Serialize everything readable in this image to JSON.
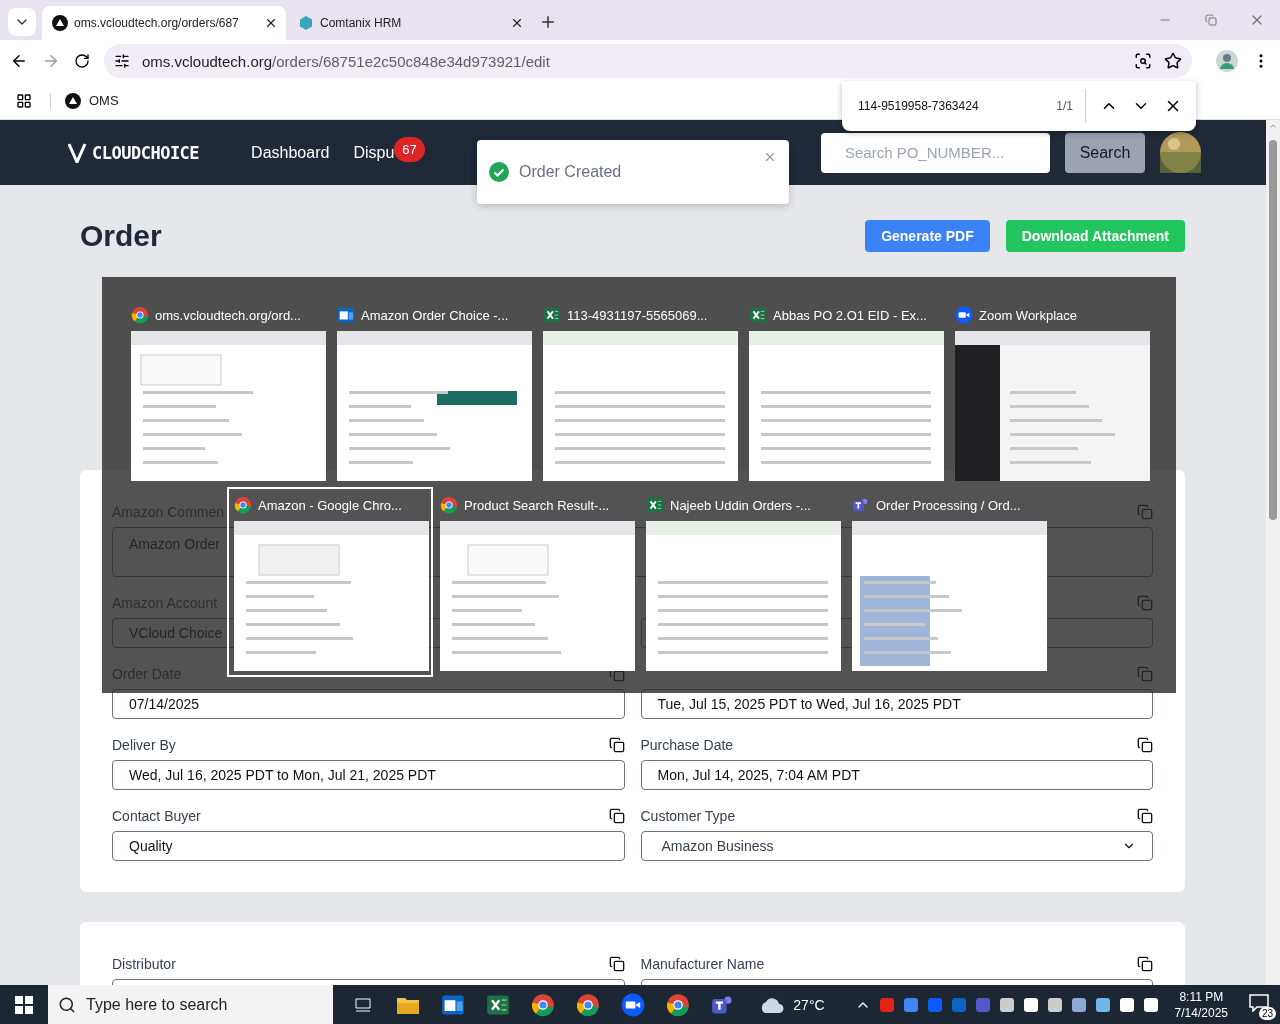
{
  "browser": {
    "tabs": [
      {
        "title": "oms.vcloudtech.org/orders/687",
        "selected": true
      },
      {
        "title": "Comtanix HRM",
        "selected": false
      }
    ],
    "address": {
      "host": "oms.vcloudtech.org",
      "path": "/orders/68751e2c50c848e34d973921/edit"
    },
    "bookmarks": [
      {
        "label": "OMS"
      }
    ],
    "find_bar": {
      "query": "114-9519958-7363424",
      "count": "1/1"
    }
  },
  "header": {
    "logo": "CLOUDCHOICE",
    "nav": [
      {
        "label": "Dashboard"
      },
      {
        "label": "Dispu",
        "badge": "67"
      }
    ],
    "search": {
      "placeholder": "Search PO_NUMBER...",
      "button": "Search"
    }
  },
  "toast": {
    "message": "Order Created"
  },
  "page": {
    "title": "Order",
    "actions": [
      {
        "label": "Generate PDF",
        "color": "#3b82f6"
      },
      {
        "label": "Download Attachment",
        "color": "#22c55e"
      }
    ]
  },
  "form": {
    "sections": [
      {
        "fields": [
          {
            "kind": "textarea",
            "label": "Amazon Commen",
            "value": "Amazon Order"
          },
          {
            "kind": "text",
            "label": "Amazon Account",
            "value": "VCloud Choice",
            "copy": false
          },
          {
            "kind": "text"
          },
          {
            "kind": "text",
            "label": "Order Date",
            "value": "07/14/2025"
          },
          {
            "kind": "text",
            "value": "Tue, Jul 15, 2025 PDT to Wed, Jul 16, 2025 PDT"
          },
          {
            "kind": "text",
            "label": "Deliver By",
            "value": "Wed, Jul 16, 2025 PDT to Mon, Jul 21, 2025 PDT"
          },
          {
            "kind": "text",
            "label": "Purchase Date",
            "value": "Mon, Jul 14, 2025, 7:04 AM PDT"
          },
          {
            "kind": "text",
            "label": "Contact Buyer",
            "value": "Quality"
          },
          {
            "kind": "select",
            "label": "Customer Type",
            "value": "Amazon Business"
          }
        ]
      },
      {
        "fields": [
          {
            "kind": "text",
            "label": "Distributor"
          },
          {
            "kind": "text",
            "label": "Manufacturer Name"
          }
        ]
      }
    ]
  },
  "switcher": {
    "rows": [
      [
        {
          "title": "oms.vcloudtech.org/ord...",
          "kind": "browser",
          "selected": false
        },
        {
          "title": "Amazon Order Choice -...",
          "kind": "mail",
          "selected": false
        },
        {
          "title": "113-4931197-5565069...",
          "kind": "sheet",
          "selected": false
        },
        {
          "title": "Abbas PO 2.O1  EID - Ex...",
          "kind": "sheet",
          "selected": false
        },
        {
          "title": "Zoom Workplace",
          "kind": "video",
          "selected": false
        }
      ],
      [
        {
          "title": "Amazon - Google Chro...",
          "kind": "browser",
          "selected": true
        },
        {
          "title": "Product Search Result-...",
          "kind": "browser",
          "selected": false
        },
        {
          "title": "Najeeb Uddin Orders -...",
          "kind": "sheet",
          "selected": false
        },
        {
          "title": "Order Processing / Ord...",
          "kind": "chat",
          "selected": false
        }
      ]
    ]
  },
  "taskbar": {
    "search_placeholder": "Type here to search",
    "weather": "27°C",
    "time": "8:11 PM",
    "date": "7/14/2025",
    "notifications": "23"
  }
}
